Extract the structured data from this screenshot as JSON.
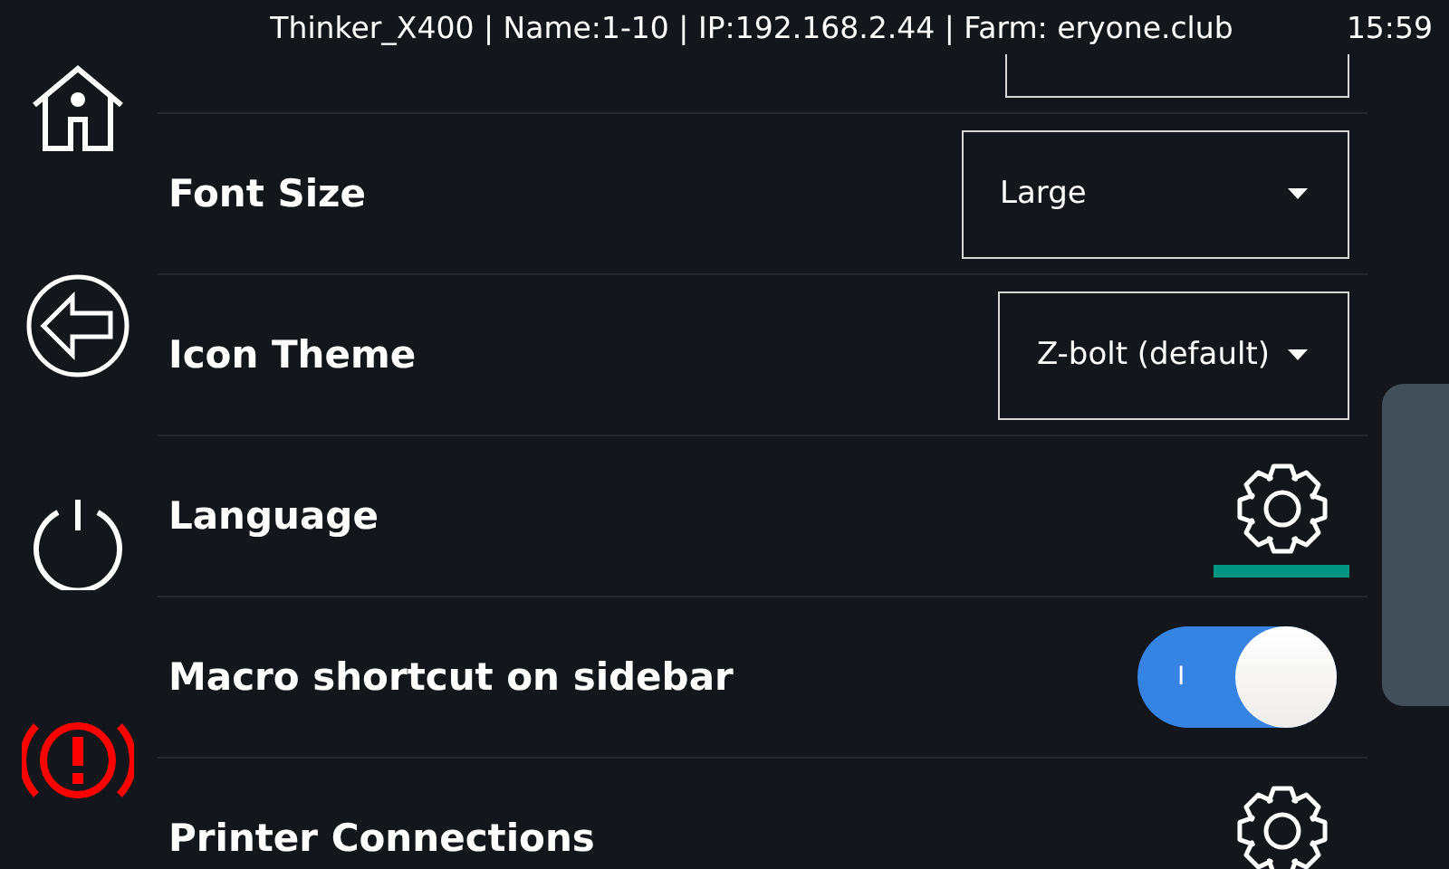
{
  "status_bar": {
    "info": "Thinker_X400 | Name:1-10 | IP:192.168.2.44 | Farm: eryone.club",
    "time": "15:59"
  },
  "sidebar": {
    "items": [
      {
        "kind": "home"
      },
      {
        "kind": "back"
      },
      {
        "kind": "power"
      },
      {
        "kind": "emergency"
      }
    ]
  },
  "settings": [
    {
      "kind": "cut"
    },
    {
      "kind": "dropdown",
      "label": "Font Size",
      "value": "Large"
    },
    {
      "kind": "dropdown",
      "label": "Icon Theme",
      "value": "Z-bolt (default)"
    },
    {
      "kind": "gear",
      "label": "Language",
      "focused": true
    },
    {
      "kind": "toggle",
      "label": "Macro shortcut on sidebar",
      "on": true,
      "mark": "I"
    },
    {
      "kind": "gear",
      "label": "Printer Connections"
    }
  ]
}
